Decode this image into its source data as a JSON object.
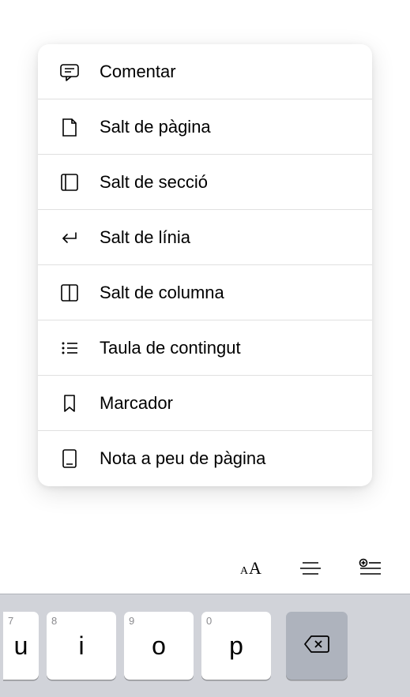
{
  "menu": {
    "items": [
      {
        "icon": "comment-icon",
        "label": "Comentar"
      },
      {
        "icon": "page-break-icon",
        "label": "Salt de pàgina"
      },
      {
        "icon": "section-break-icon",
        "label": "Salt de secció"
      },
      {
        "icon": "line-break-icon",
        "label": "Salt de línia"
      },
      {
        "icon": "column-break-icon",
        "label": "Salt de columna"
      },
      {
        "icon": "toc-icon",
        "label": "Taula de contingut"
      },
      {
        "icon": "bookmark-icon",
        "label": "Marcador"
      },
      {
        "icon": "footnote-icon",
        "label": "Nota a peu de pàgina"
      }
    ]
  },
  "toolbar": {
    "text_format": "aA",
    "paragraph": "paragraph",
    "insert": "insert"
  },
  "keyboard": {
    "keys": [
      {
        "hint": "7",
        "letter": "u"
      },
      {
        "hint": "8",
        "letter": "i"
      },
      {
        "hint": "9",
        "letter": "o"
      },
      {
        "hint": "0",
        "letter": "p"
      }
    ]
  }
}
